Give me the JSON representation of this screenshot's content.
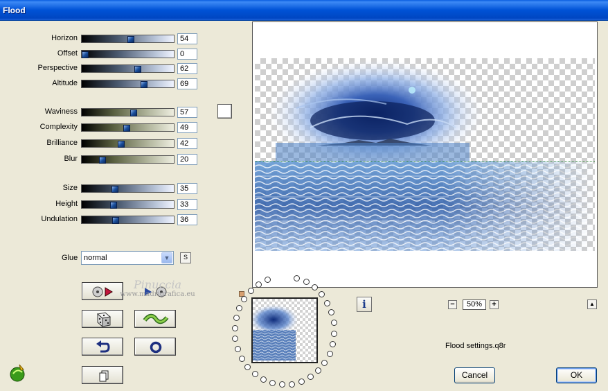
{
  "window": {
    "title": "Flood"
  },
  "sliders": [
    {
      "label": "Horizon",
      "value": "54",
      "level": 54,
      "style": "blue"
    },
    {
      "label": "Offset",
      "value": "0",
      "level": 0,
      "style": "blue"
    },
    {
      "label": "Perspective",
      "value": "62",
      "level": 62,
      "style": "blue"
    },
    {
      "label": "Altitude",
      "value": "69",
      "level": 69,
      "style": "blue"
    },
    {
      "label": "Waviness",
      "value": "57",
      "level": 57,
      "style": "olive"
    },
    {
      "label": "Complexity",
      "value": "49",
      "level": 49,
      "style": "olive"
    },
    {
      "label": "Brilliance",
      "value": "42",
      "level": 42,
      "style": "olive"
    },
    {
      "label": "Blur",
      "value": "20",
      "level": 20,
      "style": "olive"
    },
    {
      "label": "Size",
      "value": "35",
      "level": 35,
      "style": "blue"
    },
    {
      "label": "Height",
      "value": "33",
      "level": 33,
      "style": "blue"
    },
    {
      "label": "Undulation",
      "value": "36",
      "level": 36,
      "style": "blue"
    }
  ],
  "color_swatch": "#ffffff",
  "glue": {
    "label": "Glue",
    "value": "normal",
    "s_button": "S"
  },
  "watermark": {
    "line1": "Pinuccia",
    "line2": "www.madrigrafica.eu"
  },
  "tools": [
    {
      "name": "play-preset-button",
      "icon": "play-icon"
    },
    {
      "name": "next-preset-button",
      "icon": "forward-icon"
    },
    {
      "name": "randomize-button",
      "icon": "dice-icon"
    },
    {
      "name": "wave-button",
      "icon": "wave-icon"
    },
    {
      "name": "reset-button",
      "icon": "undo-icon"
    },
    {
      "name": "ring-button",
      "icon": "ring-icon"
    },
    {
      "name": "copy-button",
      "icon": "copy-icon"
    }
  ],
  "zoom": {
    "value": "50%",
    "minus": "−",
    "plus": "+"
  },
  "info_button": "i",
  "up_button": "▲",
  "settings_file": "Flood settings.q8r",
  "buttons": {
    "cancel": "Cancel",
    "ok": "OK"
  }
}
